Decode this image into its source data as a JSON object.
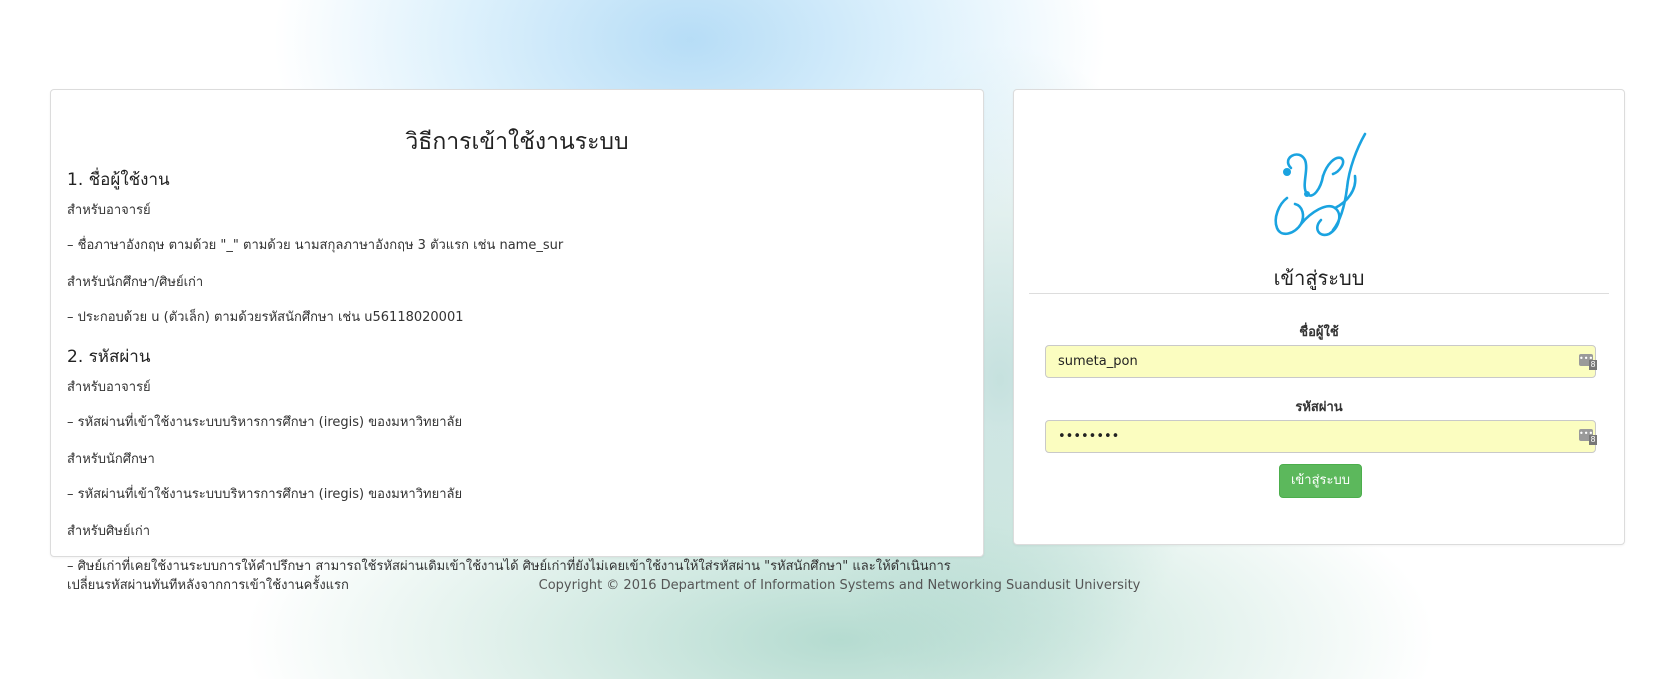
{
  "instructions": {
    "title": "วิธีการเข้าใช้งานระบบ",
    "sections": [
      {
        "heading": "1. ชื่อผู้ใช้งาน",
        "groups": [
          {
            "label": "สำหรับอาจารย์",
            "text": "– ชื่อภาษาอังกฤษ ตามด้วย \"_\" ตามด้วย นามสกุลภาษาอังกฤษ 3 ตัวแรก เช่น name_sur"
          },
          {
            "label": "สำหรับนักศึกษา/ศิษย์เก่า",
            "text": "– ประกอบด้วย u (ตัวเล็ก) ตามด้วยรหัสนักศึกษา เช่น u56118020001"
          }
        ]
      },
      {
        "heading": "2. รหัสผ่าน",
        "groups": [
          {
            "label": "สำหรับอาจารย์",
            "text": "– รหัสผ่านที่เข้าใช้งานระบบบริหารการศึกษา (iregis) ของมหาวิทยาลัย"
          },
          {
            "label": "สำหรับนักศึกษา",
            "text": "– รหัสผ่านที่เข้าใช้งานระบบบริหารการศึกษา (iregis) ของมหาวิทยาลัย"
          },
          {
            "label": "สำหรับศิษย์เก่า",
            "text": "– ศิษย์เก่าที่เคยใช้งานระบบการให้คำปรึกษา สามารถใช้รหัสผ่านเดิมเข้าใช้งานได้ ศิษย์เก่าที่ยังไม่เคยเข้าใช้งานให้ใส่รหัสผ่าน \"รหัสนักศึกษา\" และให้ดำเนินการเปลี่ยนรหัสผ่านทันทีหลังจากการเข้าใช้งานครั้งแรก"
          }
        ]
      }
    ]
  },
  "login": {
    "title": "เข้าสู่ระบบ",
    "username_label": "ชื่อผู้ใช้",
    "username_value": "sumeta_pon",
    "password_label": "รหัสผ่าน",
    "password_value": "••••••••",
    "submit_label": "เข้าสู่ระบบ",
    "keyboard_badge": "8"
  },
  "footer": {
    "copyright": "Copyright © 2016 Department of Information Systems and Networking Suandusit University"
  },
  "colors": {
    "logo": "#1aa3e0",
    "button": "#5cb85c",
    "autofill": "#fbfdc0"
  }
}
